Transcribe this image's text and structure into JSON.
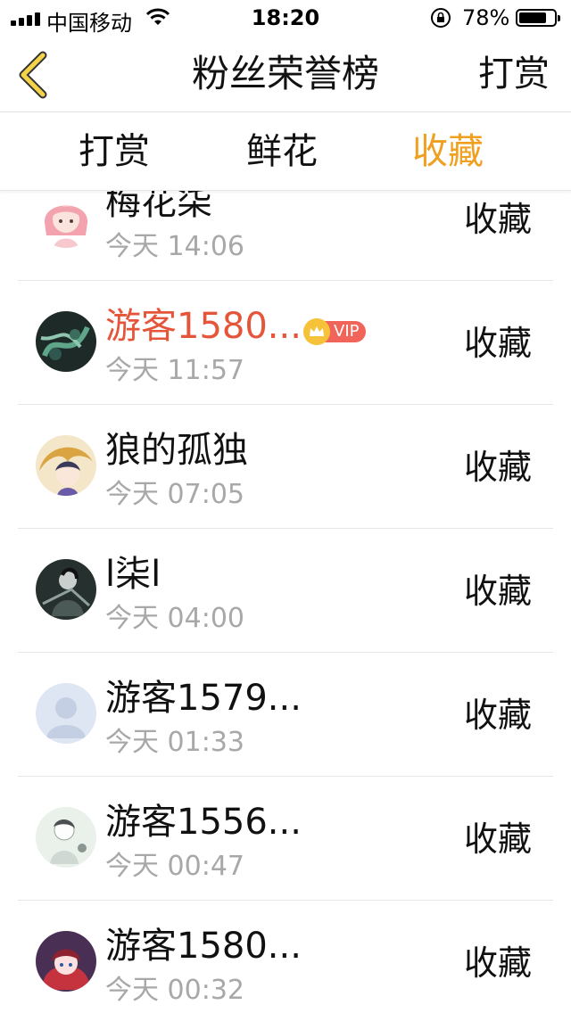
{
  "status_bar": {
    "carrier": "中国移动",
    "time": "18:20",
    "battery_percent": "78%",
    "battery_level": 0.78
  },
  "nav": {
    "title": "粉丝荣誉榜",
    "right_action": "打赏"
  },
  "tabs": [
    {
      "label": "打赏",
      "active": false
    },
    {
      "label": "鲜花",
      "active": false
    },
    {
      "label": "收藏",
      "active": true
    }
  ],
  "colors": {
    "accent": "#f0a020",
    "vip_name": "#e5553a",
    "muted": "#a8a8a8"
  },
  "vip_label": "VIP",
  "rows": [
    {
      "name": "梅花柒",
      "time": "今天 14:06",
      "action": "收藏",
      "vip": false,
      "avatar": "cartoon-girl-avatar"
    },
    {
      "name": "游客1580...",
      "time": "今天 11:57",
      "action": "收藏",
      "vip": true,
      "avatar": "dark-green-art-avatar"
    },
    {
      "name": "狼的孤独",
      "time": "今天 07:05",
      "action": "收藏",
      "vip": false,
      "avatar": "anime-dragon-avatar"
    },
    {
      "name": "l柒l",
      "time": "今天 04:00",
      "action": "收藏",
      "vip": false,
      "avatar": "dark-warrior-avatar"
    },
    {
      "name": "游客1579...",
      "time": "今天 01:33",
      "action": "收藏",
      "vip": false,
      "avatar": "default-user-avatar"
    },
    {
      "name": "游客1556...",
      "time": "今天 00:47",
      "action": "收藏",
      "vip": false,
      "avatar": "sketch-boy-avatar"
    },
    {
      "name": "游客1580...",
      "time": "今天 00:32",
      "action": "收藏",
      "vip": false,
      "avatar": "anime-girl-avatar"
    }
  ]
}
